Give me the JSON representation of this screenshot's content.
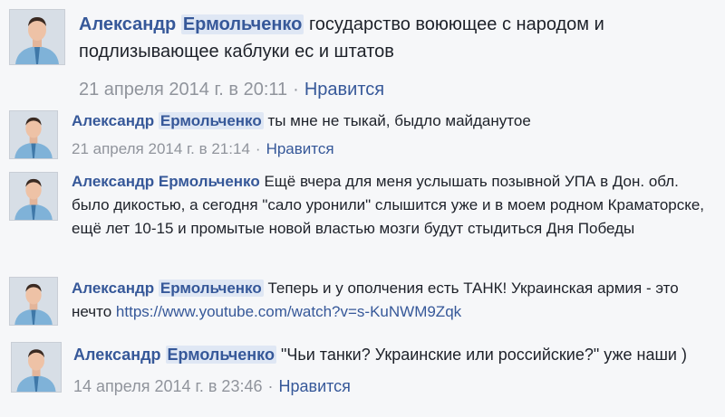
{
  "comments": [
    {
      "author_first": "Александр",
      "author_last": "Ермольченко",
      "text": "государство воюющее с народом и подлизывающее каблуки ес и штатов",
      "date": "21 апреля 2014 г. в 20:11",
      "like_label": "Нравится"
    },
    {
      "author_first": "Александр",
      "author_last": "Ермольченко",
      "text": "ты мне не тыкай, быдло майданутое",
      "date": "21 апреля 2014 г. в 21:14",
      "like_label": "Нравится"
    },
    {
      "author_first": "Александр",
      "author_last": "Ермольченко",
      "text": "Ещё вчера для меня услышать позывной УПА в Дон. обл. было дикостью, а сегодня \"сало уронили\" слышится уже и в моем родном Краматорске, ещё лет 10-15 и промытые новой властью мозги будут стыдиться Дня Победы"
    },
    {
      "author_first": "Александр",
      "author_last": "Ермольченко",
      "text": "Теперь и у ополчения есть ТАНК! Украинская армия - это нечто",
      "link": "https://www.youtube.com/watch?v=s-KuNWM9Zqk"
    },
    {
      "author_first": "Александр",
      "author_last": "Ермольченко",
      "text": "\"Чьи танки? Украинские или российские?\" уже наши )",
      "date": "14 апреля 2014 г. в 23:46",
      "like_label": "Нравится"
    }
  ]
}
